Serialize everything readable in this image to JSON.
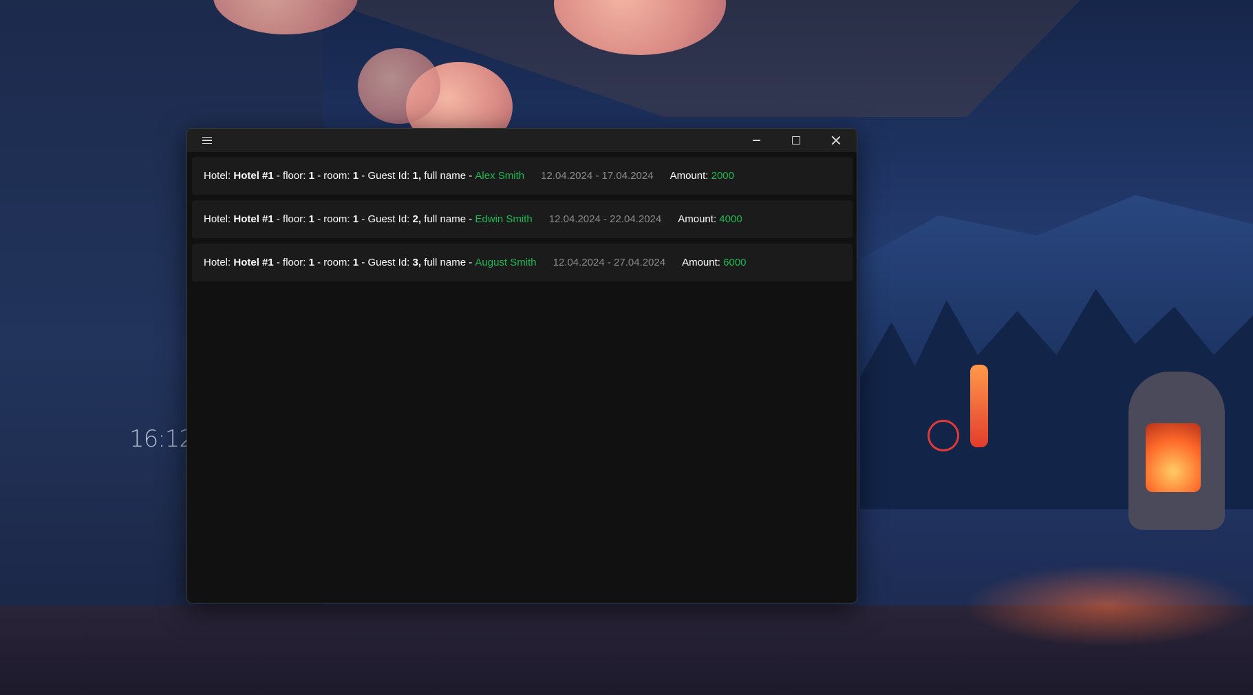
{
  "desktop": {
    "clock": "16:12"
  },
  "window": {
    "controls": {
      "menu_icon": "hamburger-icon",
      "minimize_icon": "minimize-icon",
      "maximize_icon": "maximize-icon",
      "close_icon": "close-icon"
    },
    "labels": {
      "hotel": "Hotel:",
      "floor": "- floor:",
      "room": "- room:",
      "guest_id": "- Guest Id:",
      "full_name": "full name -",
      "amount": "Amount:"
    },
    "colors": {
      "name": "#1db954",
      "amount": "#1db954",
      "dates": "#8a8a8a"
    },
    "bookings": [
      {
        "hotel": "Hotel #1",
        "floor": "1",
        "room": "1",
        "guest_id": "1,",
        "full_name": "Alex Smith",
        "dates": "12.04.2024 - 17.04.2024",
        "amount": "2000"
      },
      {
        "hotel": "Hotel #1",
        "floor": "1",
        "room": "1",
        "guest_id": "2,",
        "full_name": "Edwin Smith",
        "dates": "12.04.2024 - 22.04.2024",
        "amount": "4000"
      },
      {
        "hotel": "Hotel #1",
        "floor": "1",
        "room": "1",
        "guest_id": "3,",
        "full_name": "August Smith",
        "dates": "12.04.2024 - 27.04.2024",
        "amount": "6000"
      }
    ]
  }
}
